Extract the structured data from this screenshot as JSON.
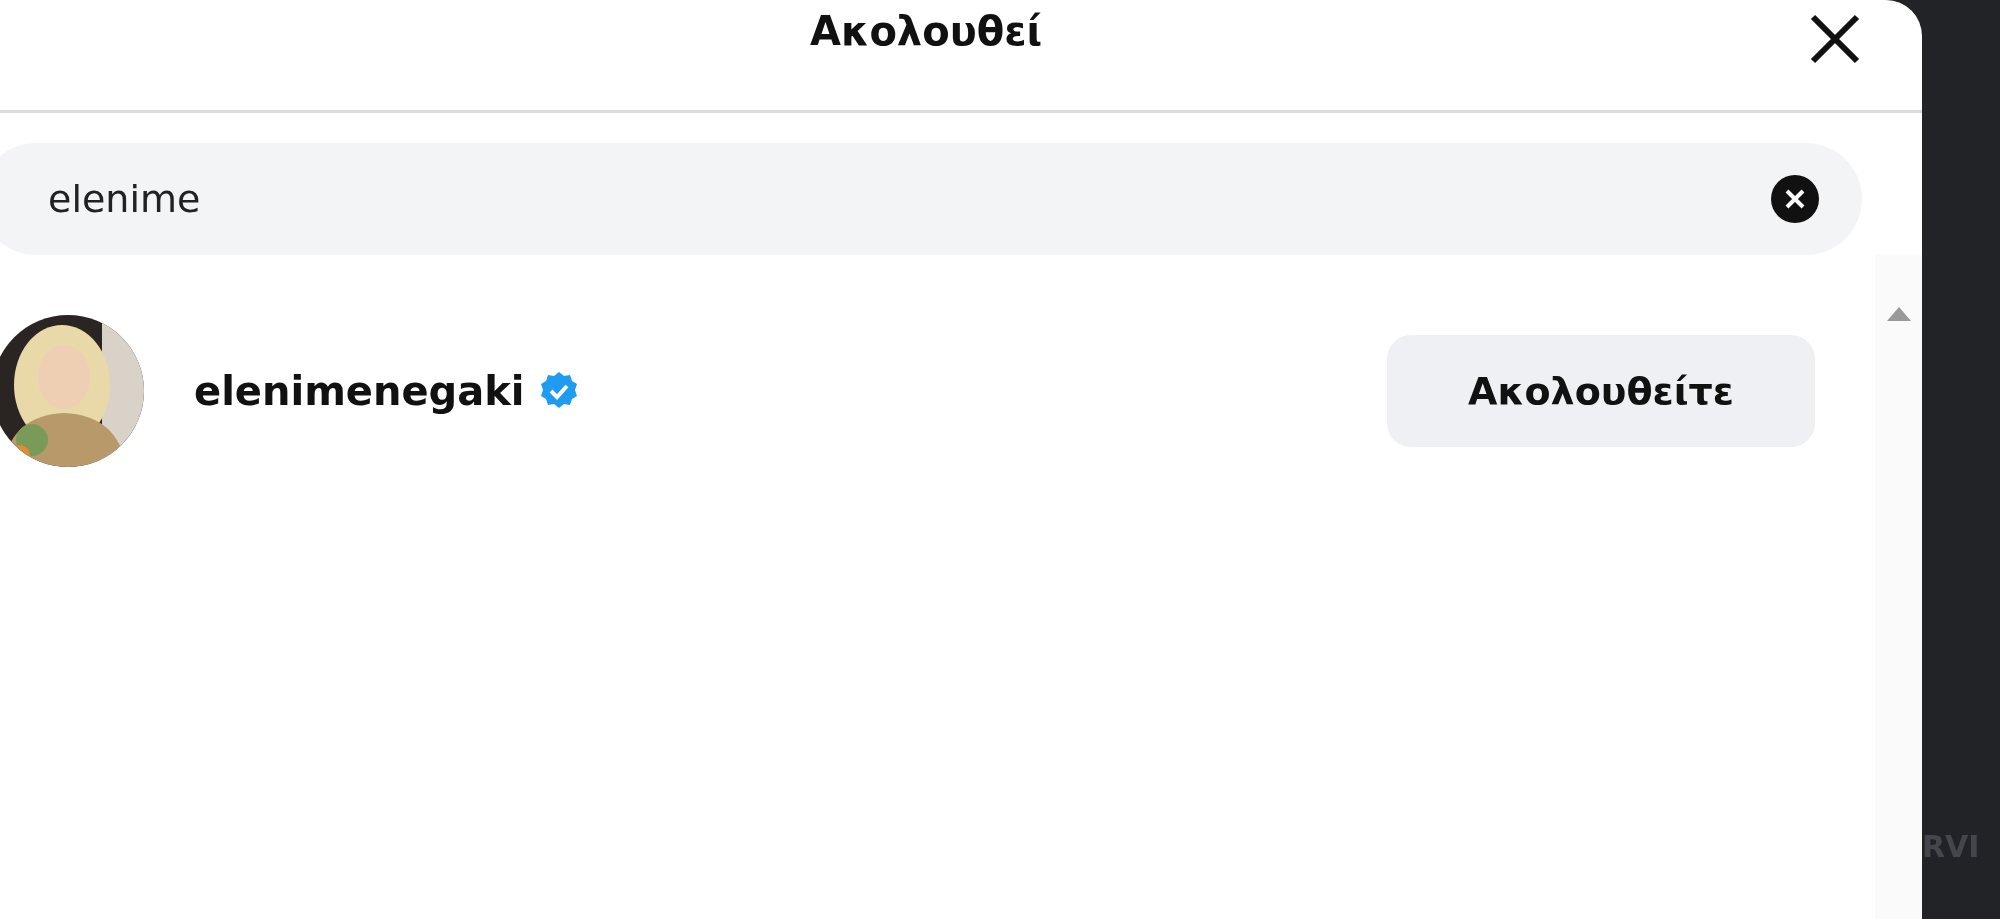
{
  "dialog": {
    "title": "Ακολουθεί"
  },
  "search": {
    "value": "elenime"
  },
  "results": [
    {
      "username": "elenimenegaki",
      "verified": true,
      "button": "Ακολουθείτε"
    }
  ],
  "background": {
    "text": "RVI"
  }
}
